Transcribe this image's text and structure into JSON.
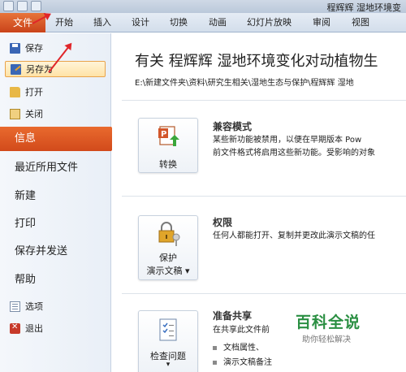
{
  "window_title": "程辉辉 湿地环境变",
  "ribbon": {
    "file_tab": "文件",
    "tabs": [
      "开始",
      "插入",
      "设计",
      "切换",
      "动画",
      "幻灯片放映",
      "审阅",
      "视图"
    ]
  },
  "nav": {
    "commands_top": [
      {
        "label": "保存",
        "icon": "save-icon"
      },
      {
        "label": "另存为",
        "icon": "save-as-icon"
      },
      {
        "label": "打开",
        "icon": "open-folder-icon"
      },
      {
        "label": "关闭",
        "icon": "close-document-icon"
      }
    ],
    "tabs": [
      "信息",
      "最近所用文件",
      "新建",
      "打印",
      "保存并发送",
      "帮助"
    ],
    "commands_bottom": [
      {
        "label": "选项",
        "icon": "options-icon"
      },
      {
        "label": "退出",
        "icon": "exit-icon"
      }
    ],
    "active_tab": "信息",
    "highlighted_command": "另存为"
  },
  "main": {
    "doc_title": "有关 程辉辉 湿地环境变化对动植物生",
    "doc_path": "E:\\新建文件夹\\资料\\研究生相关\\湿地生态与保护\\程辉辉 湿地",
    "sections": [
      {
        "button_label": "转换",
        "button_icon": "convert-icon",
        "heading": "兼容模式",
        "lines": [
          "某些新功能被禁用，以便在早期版本 Pow",
          "前文件格式将启用这些新功能。受影响的对象"
        ]
      },
      {
        "button_label": [
          "保护",
          "演示文稿 ▾"
        ],
        "button_icon": "lock-key-icon",
        "heading": "权限",
        "lines": [
          "任何人都能打开、复制并更改此演示文稿的任"
        ]
      },
      {
        "button_label": [
          "检查问题",
          "▾"
        ],
        "button_icon": "checklist-icon",
        "heading": "准备共享",
        "lines": [
          "在共享此文件前"
        ],
        "bullets": [
          "文档属性、",
          "演示文稿备注"
        ]
      }
    ]
  },
  "watermark": {
    "title": "百科全说",
    "subtitle": "助你轻松解决"
  },
  "colors": {
    "file_tab": "#d24a1b",
    "active_nav": "#e0602a",
    "annotation_arrow": "#e0262a",
    "watermark_green": "#2a8f42"
  }
}
